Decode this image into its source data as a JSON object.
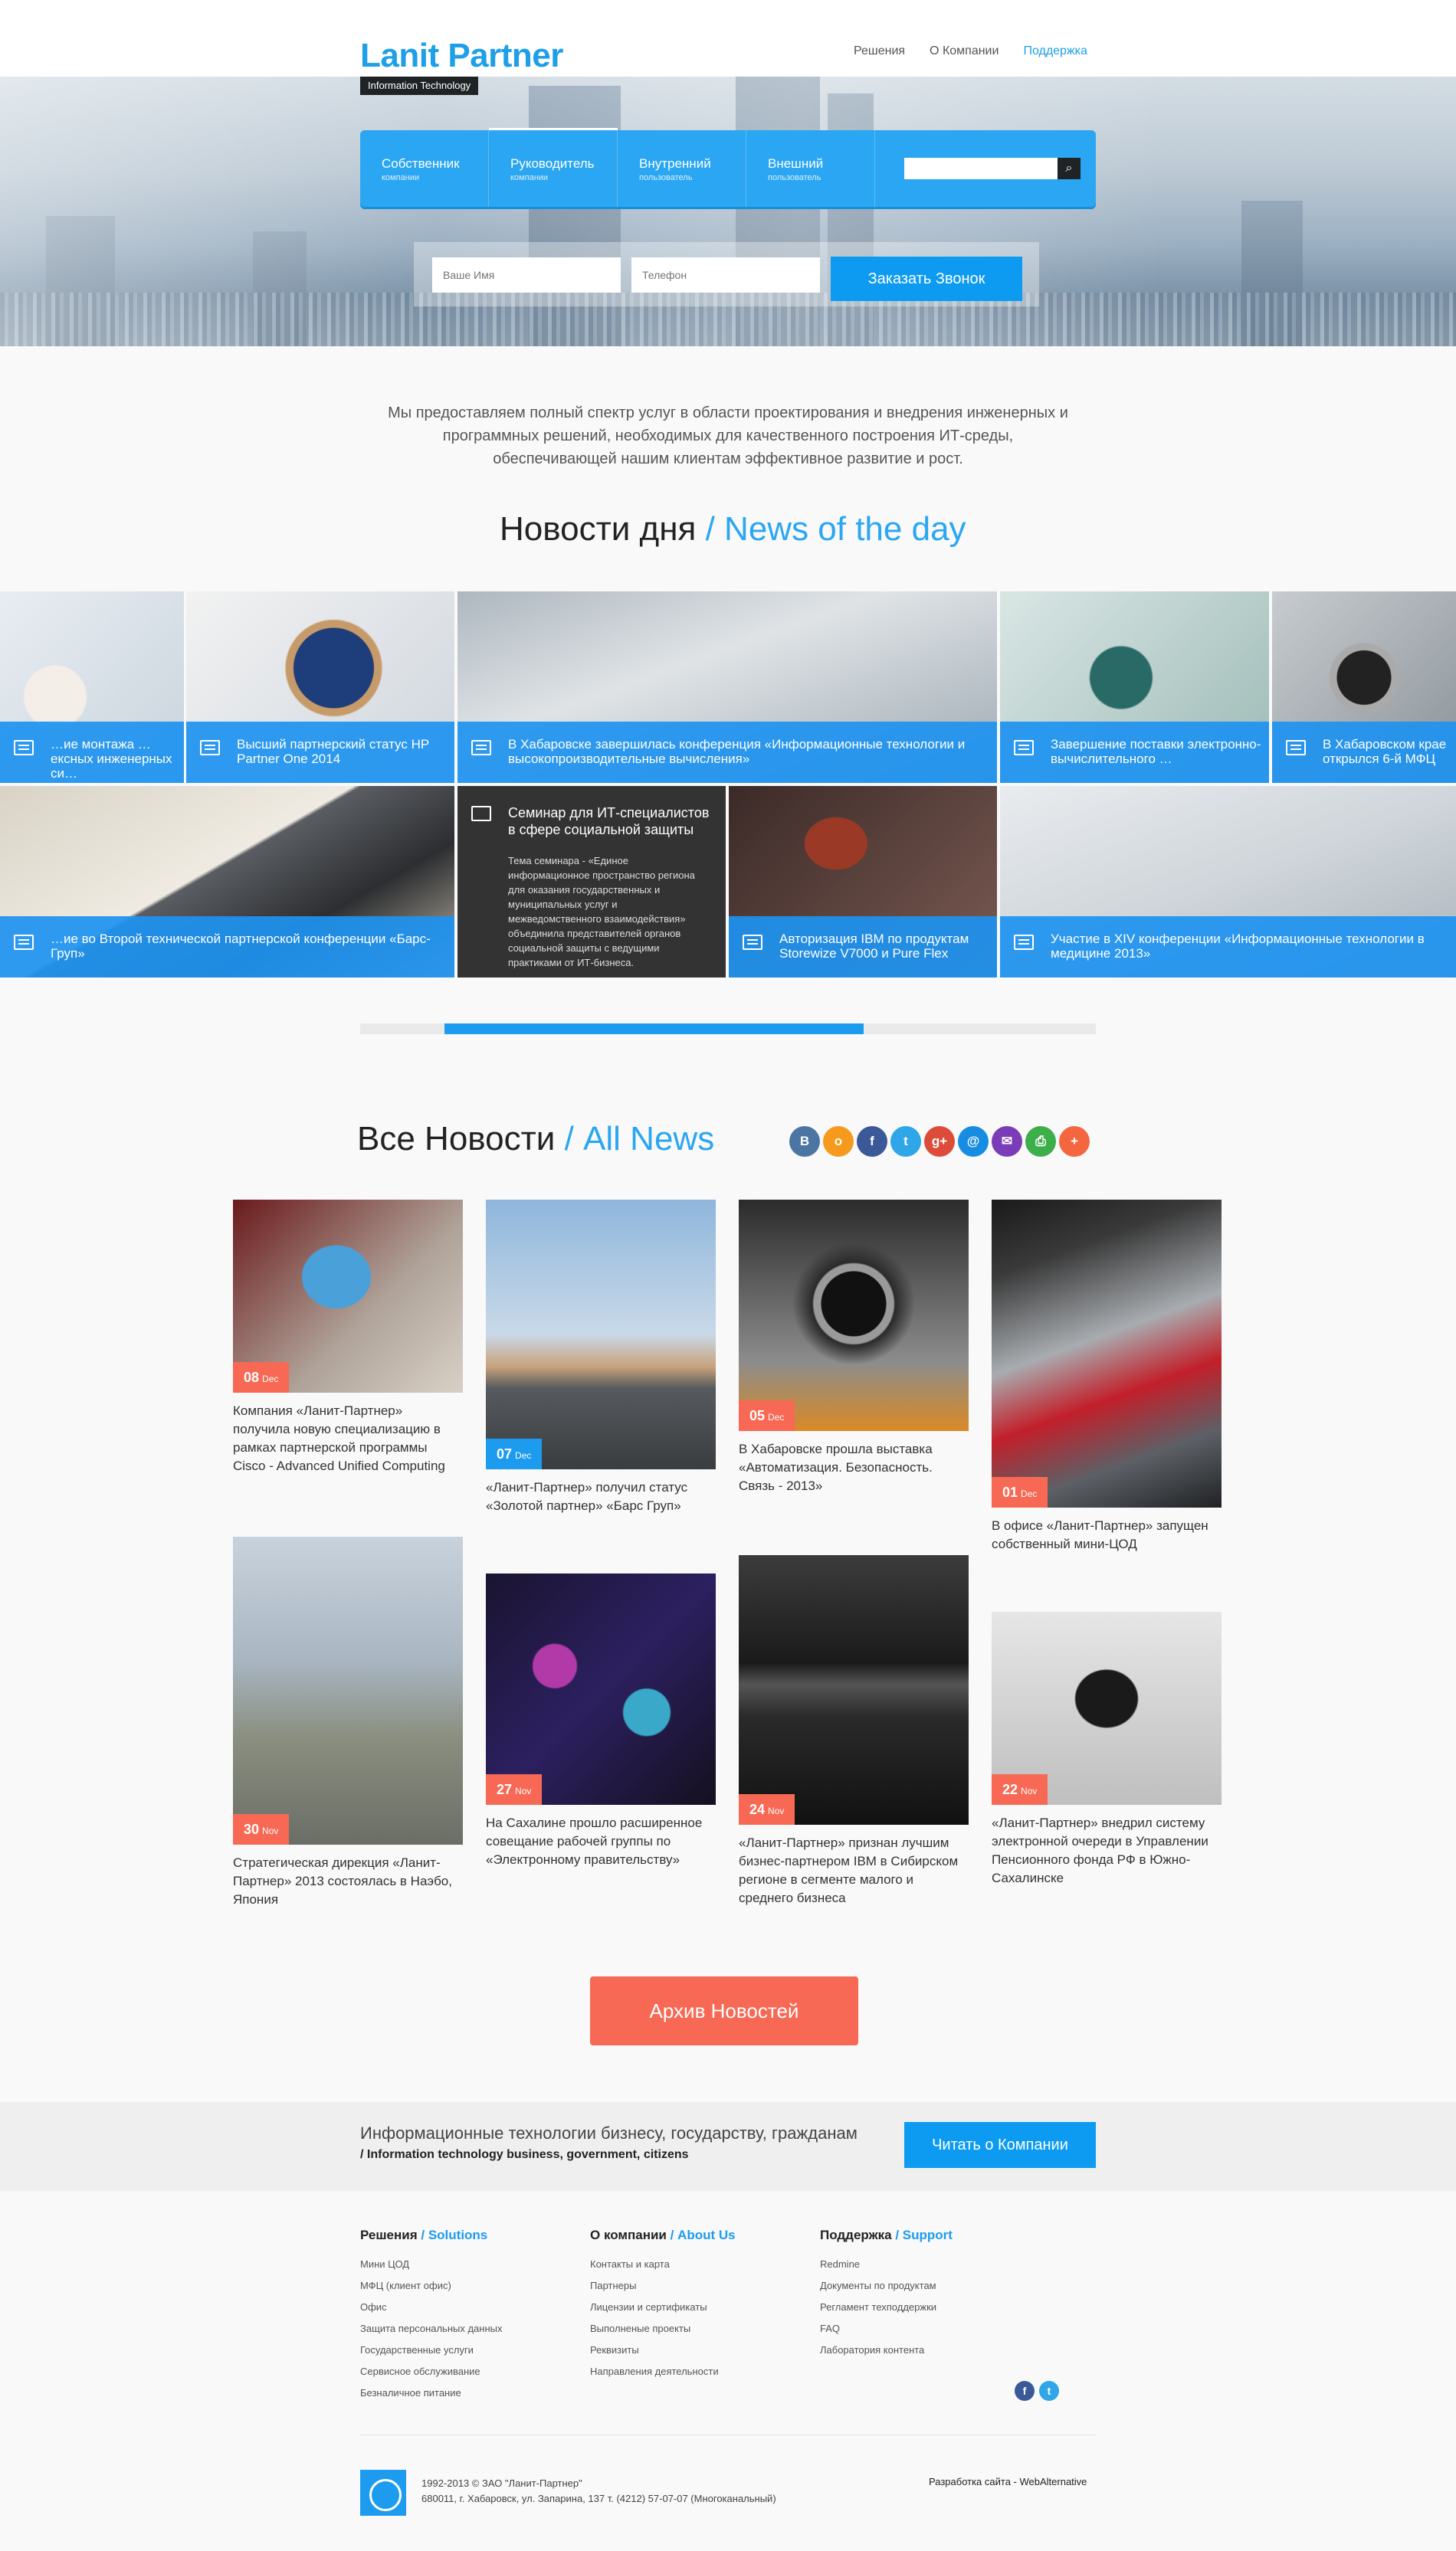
{
  "header": {
    "logo": "Lanit Partner",
    "tagline": "Information Technology",
    "nav": [
      "Решения",
      "О Компании",
      "Поддержка"
    ]
  },
  "mainnav": {
    "items": [
      {
        "title": "Собственник",
        "sub": "компании"
      },
      {
        "title": "Руководитель",
        "sub": "компании"
      },
      {
        "title": "Внутренний",
        "sub": "пользователь"
      },
      {
        "title": "Внешний",
        "sub": "пользователь"
      }
    ],
    "search_icon": "search-icon"
  },
  "callform": {
    "name_placeholder": "Ваше Имя",
    "phone_placeholder": "Телефон",
    "button": "Заказать Звонок"
  },
  "intro": "Мы предоставляем полный спектр услуг в области проектирования и внедрения инженерных и программных решений, необходимых для качественного построения ИТ-среды, обеспечивающей нашим клиентам эффективное развитие и рост.",
  "news_day": {
    "title": "Новости дня",
    "title_alt": "/ News of the day",
    "tiles": [
      "…ие монтажа …ексных инженерных си…",
      "Высший партнерский статус HP Partner One 2014",
      "В Хабаровске завершилась конференция «Информационные технологии и высокопроизводительные вычисления»",
      "Завершение поставки электронно-вычислительного …",
      "В Хабаровском крае открылся 6-й МФЦ",
      "…ие во Второй технической партнерской конференции «Барс-Груп»",
      "Авторизация IBM по продуктам Storewize V7000 и Pure Flex",
      "Участие в XIV конференции «Информационные технологии в медицине 2013»"
    ],
    "dark_tile": {
      "title": "Семинар для ИТ-специалистов в сфере социальной защиты",
      "text": "Тема семинара - «Единое информационное пространство региона для оказания государственных и муниципальных услуг и межведомственного взаимодействия» объединила представителей органов социальной защиты с ведущими практиками от ИТ-бизнеса."
    },
    "progress": 0.57
  },
  "all_news": {
    "title": "Все Новости",
    "title_alt": "/ All News",
    "share": [
      "В",
      "о",
      "f",
      "t",
      "g+",
      "@",
      "✉",
      "⎙",
      "+"
    ],
    "cards": [
      {
        "day": "08",
        "mon": "Dec",
        "text": "Компания «Ланит-Партнер» получила новую специализацию в рамках партнерской программы Cisco - Advanced Unified Computing"
      },
      {
        "day": "07",
        "mon": "Dec",
        "text": "«Ланит-Партнер» получил статус «Золотой партнер» «Барс Груп»"
      },
      {
        "day": "05",
        "mon": "Dec",
        "text": "В Хабаровске прошла выставка «Автоматизация. Безопасность. Связь - 2013»"
      },
      {
        "day": "01",
        "mon": "Dec",
        "text": "В офисе «Ланит-Партнер» запущен собственный мини-ЦОД"
      },
      {
        "day": "30",
        "mon": "Nov",
        "text": "Стратегическая дирекция «Ланит-Партнер» 2013 состоялась в Наэбо, Япония"
      },
      {
        "day": "27",
        "mon": "Nov",
        "text": "На Сахалине прошло расширенное совещание рабочей группы по «Электронному правительству»"
      },
      {
        "day": "24",
        "mon": "Nov",
        "text": "«Ланит-Партнер» признан лучшим бизнес-партнером IBM в Сибирском регионе в сегменте малого и среднего бизнеса"
      },
      {
        "day": "22",
        "mon": "Nov",
        "text": "«Ланит-Партнер» внедрил систему электронной очереди в Управлении Пенсионного фонда РФ в Южно-Сахалинске"
      }
    ],
    "archive_button": "Архив Новостей"
  },
  "band": {
    "line1": "Информационные технологии бизнесу, государству, гражданам",
    "line2": "/ Information technology business, government, citizens",
    "button": "Читать о Компании"
  },
  "footer": {
    "cols": [
      {
        "title": "Решения",
        "alt": "/ Solutions",
        "links": [
          "Мини ЦОД",
          "МФЦ (клиент офис)",
          "Офис",
          "Защита персональных данных",
          "Государственные услуги",
          "Сервисное обслуживание",
          "Безналичное питание"
        ]
      },
      {
        "title": "О компании",
        "alt": "/ About Us",
        "links": [
          "Контакты и карта",
          "Партнеры",
          "Лицензии и сертификаты",
          "Выполненые проекты",
          "Реквизиты",
          "Направления деятельности"
        ]
      },
      {
        "title": "Поддержка",
        "alt": "/ Support",
        "links": [
          "Redmine",
          "Документы по продуктам",
          "Регламент техподдержки",
          "FAQ",
          "Лаборатория контента"
        ]
      }
    ],
    "copy1": "1992-2013 © ЗАО \"Ланит-Партнер\"",
    "copy2": "680011, г. Хабаровск, ул. Запарина, 137   т. (4212) 57-07-07 (Многоканальный)",
    "dev": "Разработка сайта - WebAlternative",
    "colors": {
      "accent": "#1c9bef",
      "orange": "#f76954",
      "dark": "#1f2326"
    }
  }
}
